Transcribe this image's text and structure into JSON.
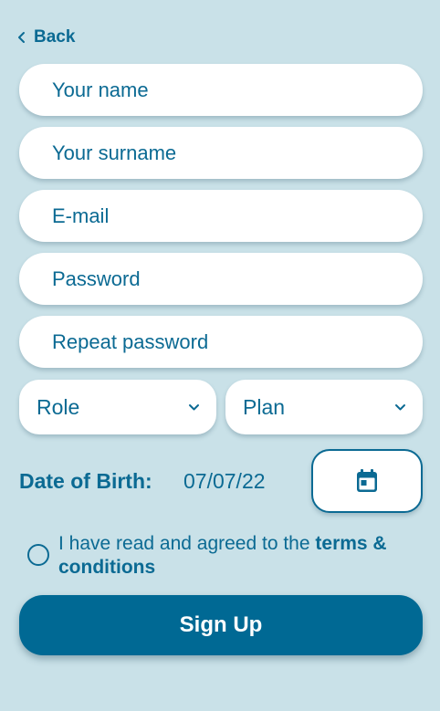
{
  "colors": {
    "background": "#c9e1e8",
    "accent": "#0b6a93",
    "button": "#006994",
    "field": "#ffffff"
  },
  "nav": {
    "back_label": "Back",
    "back_icon": "chevron-left-icon"
  },
  "form": {
    "name_placeholder": "Your name",
    "surname_placeholder": "Your surname",
    "email_placeholder": "E-mail",
    "password_placeholder": "Password",
    "repeat_password_placeholder": "Repeat password",
    "role_label": "Role",
    "plan_label": "Plan",
    "dropdown_icon": "chevron-down-icon"
  },
  "dob": {
    "label": "Date of Birth:",
    "value": "07/07/22",
    "picker_icon": "calendar-icon"
  },
  "terms": {
    "prefix": "I have read and agreed to the ",
    "link": "terms & conditions",
    "checked": false
  },
  "signup": {
    "label": "Sign Up"
  }
}
